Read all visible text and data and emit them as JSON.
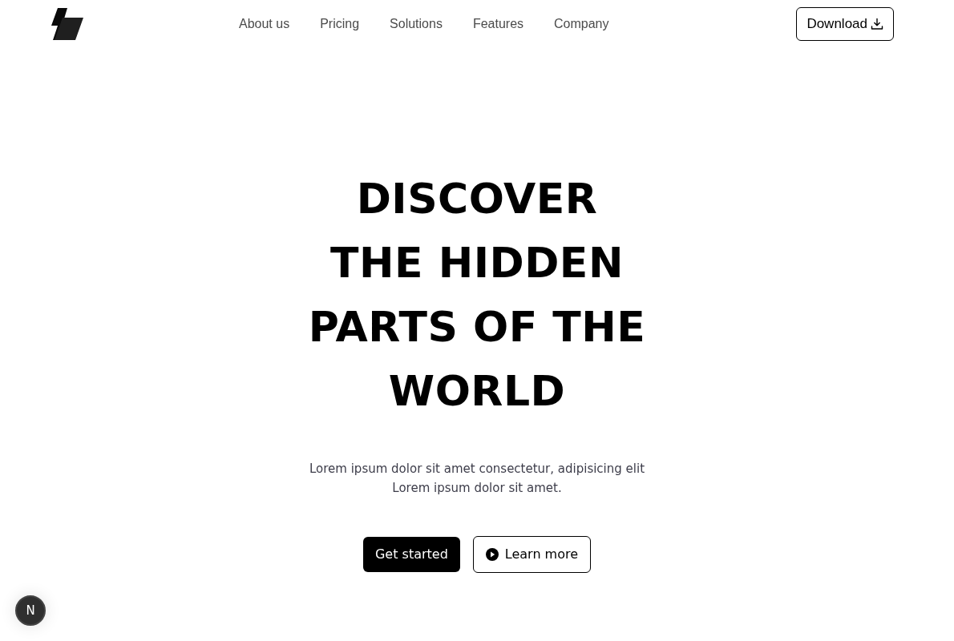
{
  "nav": {
    "links": [
      "About us",
      "Pricing",
      "Solutions",
      "Features",
      "Company"
    ],
    "download_button": {
      "label": "Download"
    }
  },
  "hero": {
    "heading_lines": [
      "DISCOVER",
      "THE HIDDEN",
      "PARTS OF THE",
      "WORLD"
    ],
    "description_lines": [
      "Lorem ipsum dolor sit amet consectetur, adipisicing elit",
      "Lorem ipsum dolor sit amet."
    ],
    "buttons": [
      {
        "label": "Get started",
        "kind": "primary"
      },
      {
        "label": "Learn more",
        "kind": "outline"
      }
    ]
  },
  "dev_badge": {
    "label": "N"
  }
}
